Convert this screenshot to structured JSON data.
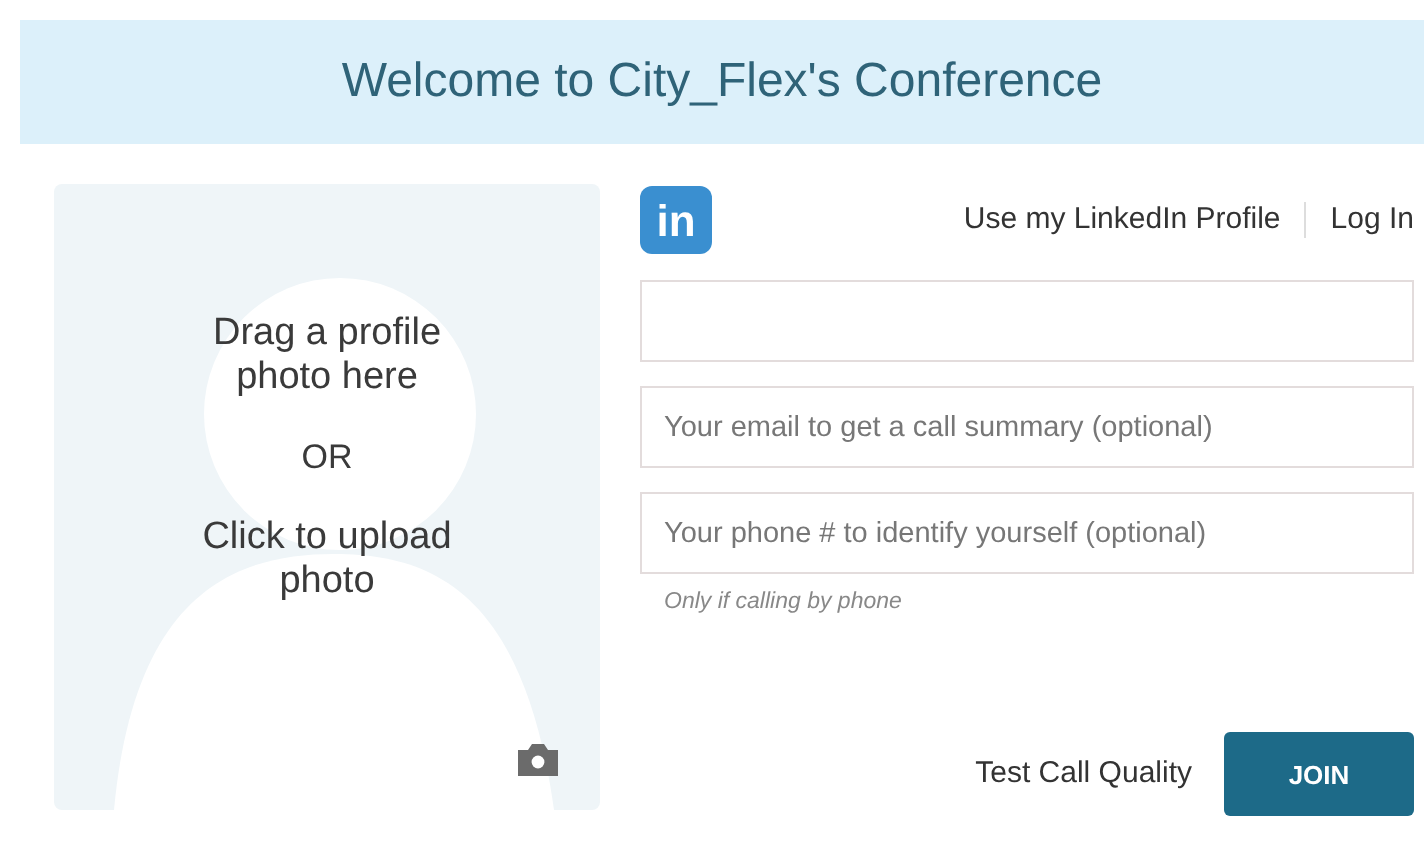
{
  "header": {
    "title": "Welcome to City_Flex's Conference"
  },
  "photo_upload": {
    "drag_text": "Drag a profile photo here",
    "or_text": "OR",
    "click_text": "Click to upload photo"
  },
  "linkedin": {
    "logo": "in",
    "link": "Use my LinkedIn Profile",
    "login": "Log In"
  },
  "fields": [
    {
      "placeholder": "Your email to get a call summary (optional)"
    },
    {
      "placeholder": "Your phone # to identify yourself (optional)",
      "hint": "Only if calling by phone"
    }
  ],
  "actions": {
    "test": "Test Call Quality",
    "join": "JOIN"
  }
}
